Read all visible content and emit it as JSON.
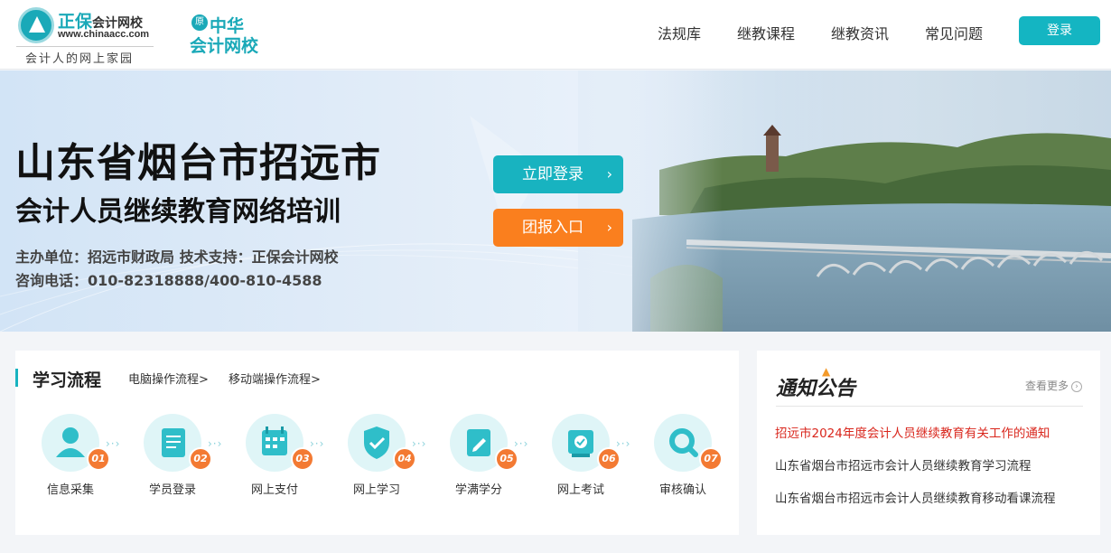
{
  "brand": {
    "logo_name": "正保",
    "logo_name_sub": "会计网校",
    "logo_url": "www.chinaacc.com",
    "slogan": "会计人的网上家园",
    "logo2_mark": "原",
    "logo2_line1": "中华",
    "logo2_line2": "会计网校",
    "accent_color": "#18b3c0",
    "orange_color": "#fa7f1e"
  },
  "nav": {
    "items": [
      {
        "label": "法规库"
      },
      {
        "label": "继教课程"
      },
      {
        "label": "继教资讯"
      },
      {
        "label": "常见问题"
      }
    ],
    "login_label": "登录"
  },
  "banner": {
    "title": "山东省烟台市招远市",
    "subtitle": "会计人员继续教育网络培训",
    "info_line1": "主办单位：招远市财政局  技术支持：正保会计网校",
    "info_line2": "咨询电话：010-82318888/400-810-4588",
    "login_button": "立即登录",
    "group_button": "团报入口"
  },
  "process": {
    "title": "学习流程",
    "link_pc": "电脑操作流程>",
    "link_mobile": "移动端操作流程>",
    "steps": [
      {
        "num": "01",
        "label": "信息采集",
        "icon": "user-icon"
      },
      {
        "num": "02",
        "label": "学员登录",
        "icon": "document-icon"
      },
      {
        "num": "03",
        "label": "网上支付",
        "icon": "calendar-icon"
      },
      {
        "num": "04",
        "label": "网上学习",
        "icon": "shield-check-icon"
      },
      {
        "num": "05",
        "label": "学满学分",
        "icon": "edit-icon"
      },
      {
        "num": "06",
        "label": "网上考试",
        "icon": "exam-scroll-icon"
      },
      {
        "num": "07",
        "label": "审核确认",
        "icon": "search-icon"
      }
    ]
  },
  "notice": {
    "title": "通知公告",
    "more": "查看更多",
    "items": [
      {
        "text": "招远市2024年度会计人员继续教育有关工作的通知"
      },
      {
        "text": "山东省烟台市招远市会计人员继续教育学习流程"
      },
      {
        "text": "山东省烟台市招远市会计人员继续教育移动看课流程"
      }
    ]
  }
}
